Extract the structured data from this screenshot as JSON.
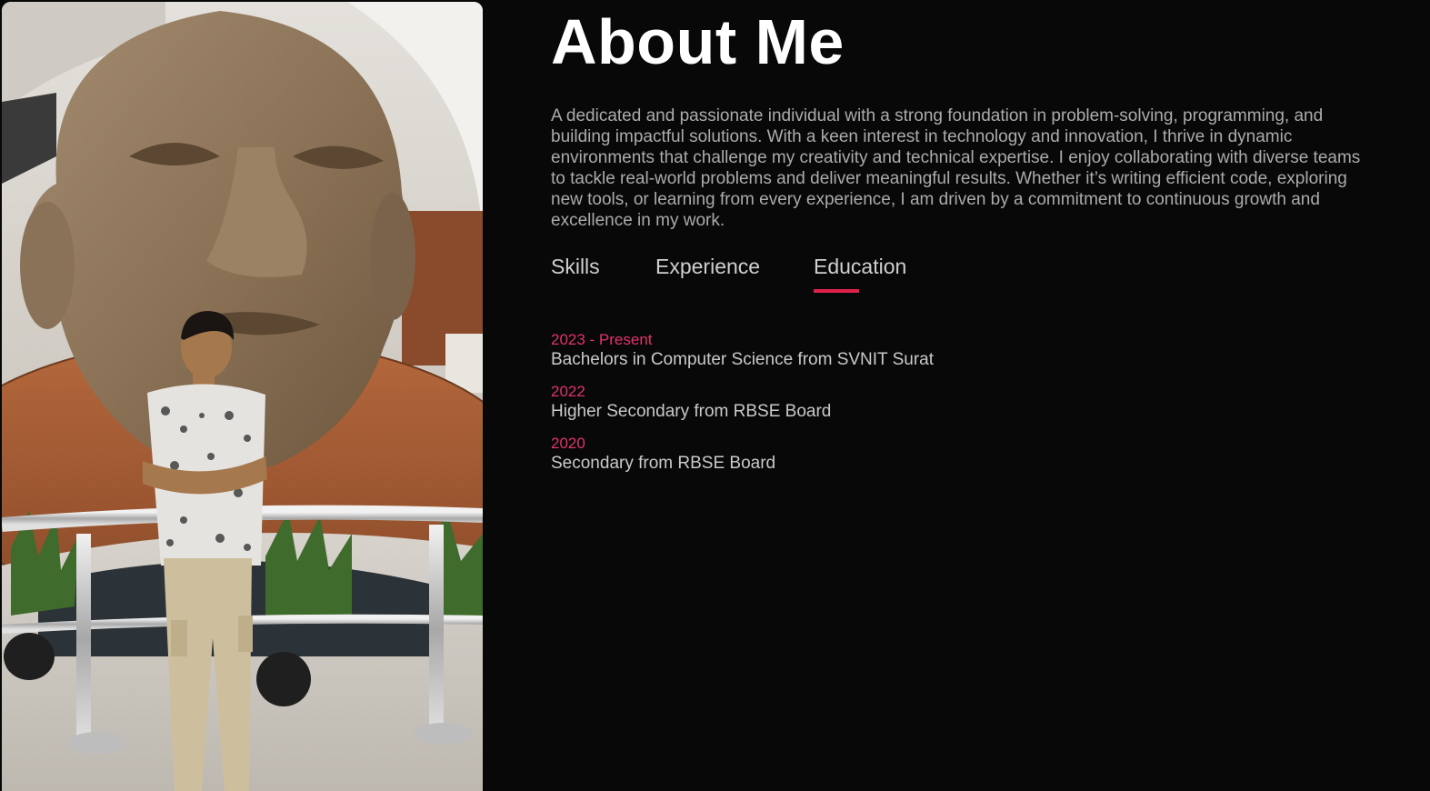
{
  "about": {
    "title": "About Me",
    "bio": "A dedicated and passionate individual with a strong foundation in problem-solving, programming, and building impactful solutions. With a keen interest in technology and innovation, I thrive in dynamic environments that challenge my creativity and technical expertise. I enjoy collaborating with diverse teams to tackle real-world problems and deliver meaningful results. Whether it’s writing efficient code, exploring new tools, or learning from every experience, I am driven by a commitment to continuous growth and excellence in my work."
  },
  "tabs": [
    {
      "label": "Skills",
      "active": false
    },
    {
      "label": "Experience",
      "active": false
    },
    {
      "label": "Education",
      "active": true
    }
  ],
  "education": [
    {
      "year": "2023 - Present",
      "desc": "Bachelors in Computer Science from SVNIT Surat"
    },
    {
      "year": "2022",
      "desc": "Higher Secondary from RBSE Board"
    },
    {
      "year": "2020",
      "desc": "Secondary from RBSE Board"
    }
  ],
  "colors": {
    "background": "#080808",
    "accent": "#e0204a",
    "year_text": "#e0336a",
    "heading": "#ffffff",
    "body_text": "#ababab"
  }
}
